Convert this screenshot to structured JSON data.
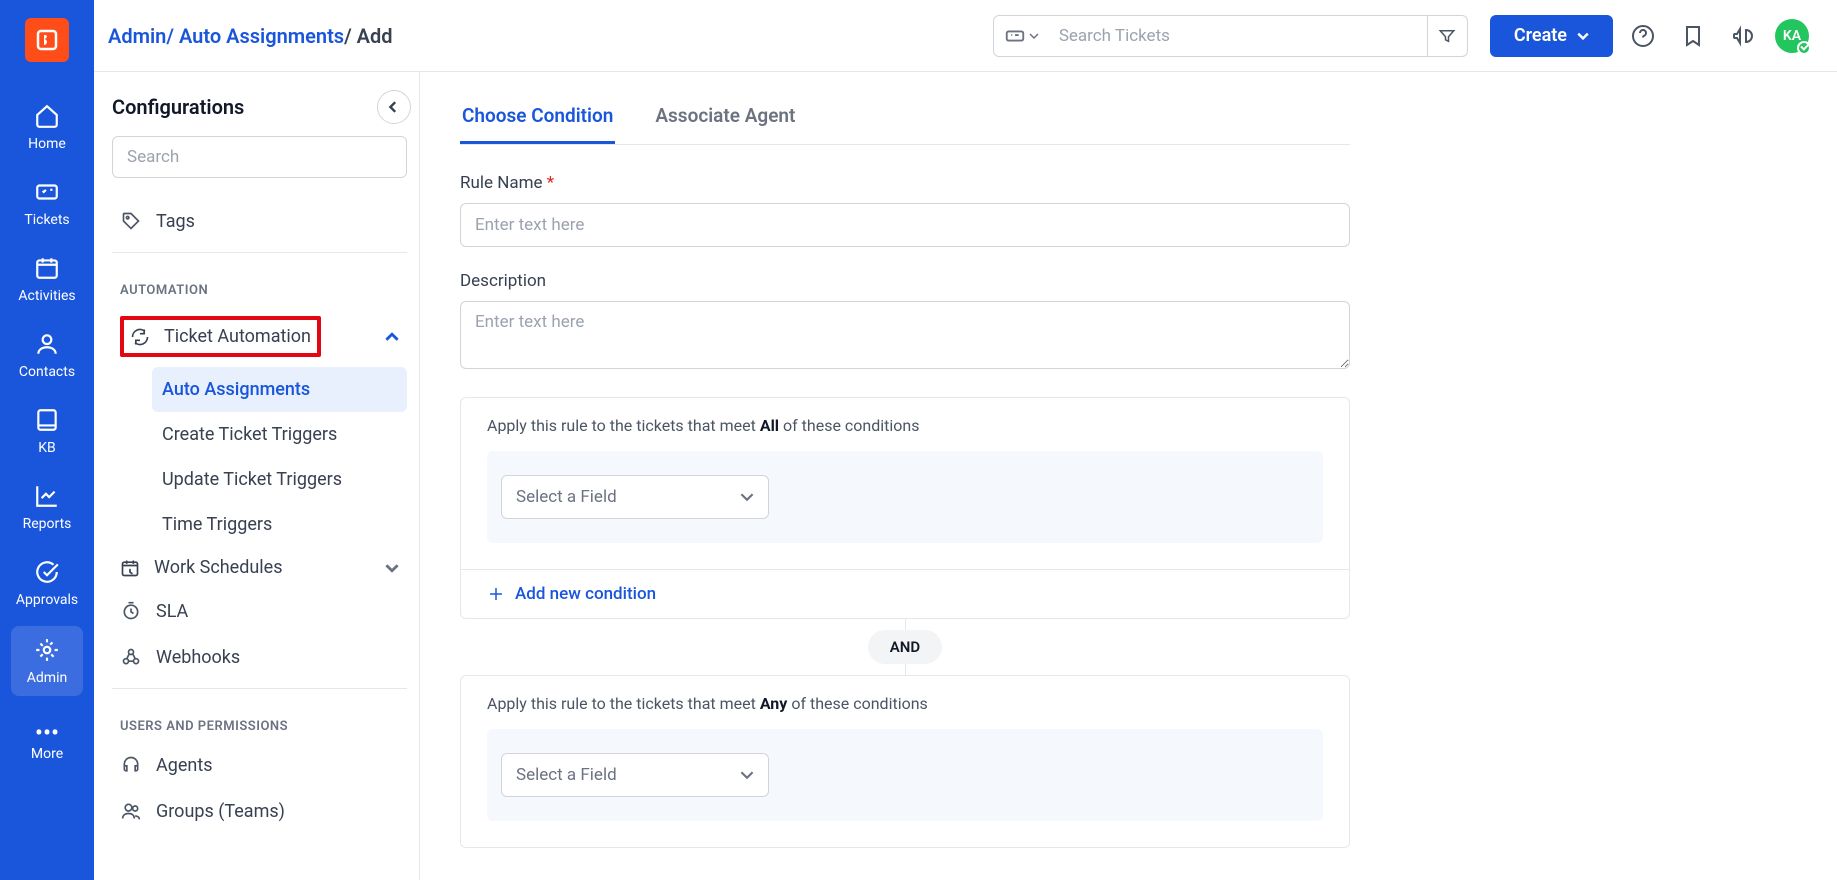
{
  "rail": {
    "items": [
      {
        "label": "Home"
      },
      {
        "label": "Tickets"
      },
      {
        "label": "Activities"
      },
      {
        "label": "Contacts"
      },
      {
        "label": "KB"
      },
      {
        "label": "Reports"
      },
      {
        "label": "Approvals"
      },
      {
        "label": "Admin"
      },
      {
        "label": "More"
      }
    ]
  },
  "header": {
    "breadcrumb": {
      "admin": "Admin",
      "mid": "Auto Assignments",
      "last": "Add"
    },
    "search_placeholder": "Search Tickets",
    "create_label": "Create",
    "avatar_initials": "KA"
  },
  "sidebar": {
    "title": "Configurations",
    "search_placeholder": "Search",
    "tags_label": "Tags",
    "section_automation": "AUTOMATION",
    "ticket_automation_label": "Ticket Automation",
    "sub_items": [
      "Auto Assignments",
      "Create Ticket Triggers",
      "Update Ticket Triggers",
      "Time Triggers"
    ],
    "work_schedules_label": "Work Schedules",
    "sla_label": "SLA",
    "webhooks_label": "Webhooks",
    "section_users_perms": "USERS AND PERMISSIONS",
    "agents_label": "Agents",
    "groups_label": "Groups (Teams)"
  },
  "content": {
    "tabs": [
      "Choose Condition",
      "Associate Agent"
    ],
    "rule_name_label": "Rule Name",
    "description_label": "Description",
    "enter_placeholder": "Enter text here",
    "cond_all_prefix": "Apply this rule to the tickets that meet ",
    "cond_all_bold": "All",
    "cond_all_suffix": " of these conditions",
    "select_field_label": "Select a Field",
    "add_condition_label": "Add new condition",
    "connector_label": "AND",
    "cond_any_prefix": "Apply this rule to the tickets that meet ",
    "cond_any_bold": "Any",
    "cond_any_suffix": " of these conditions"
  }
}
